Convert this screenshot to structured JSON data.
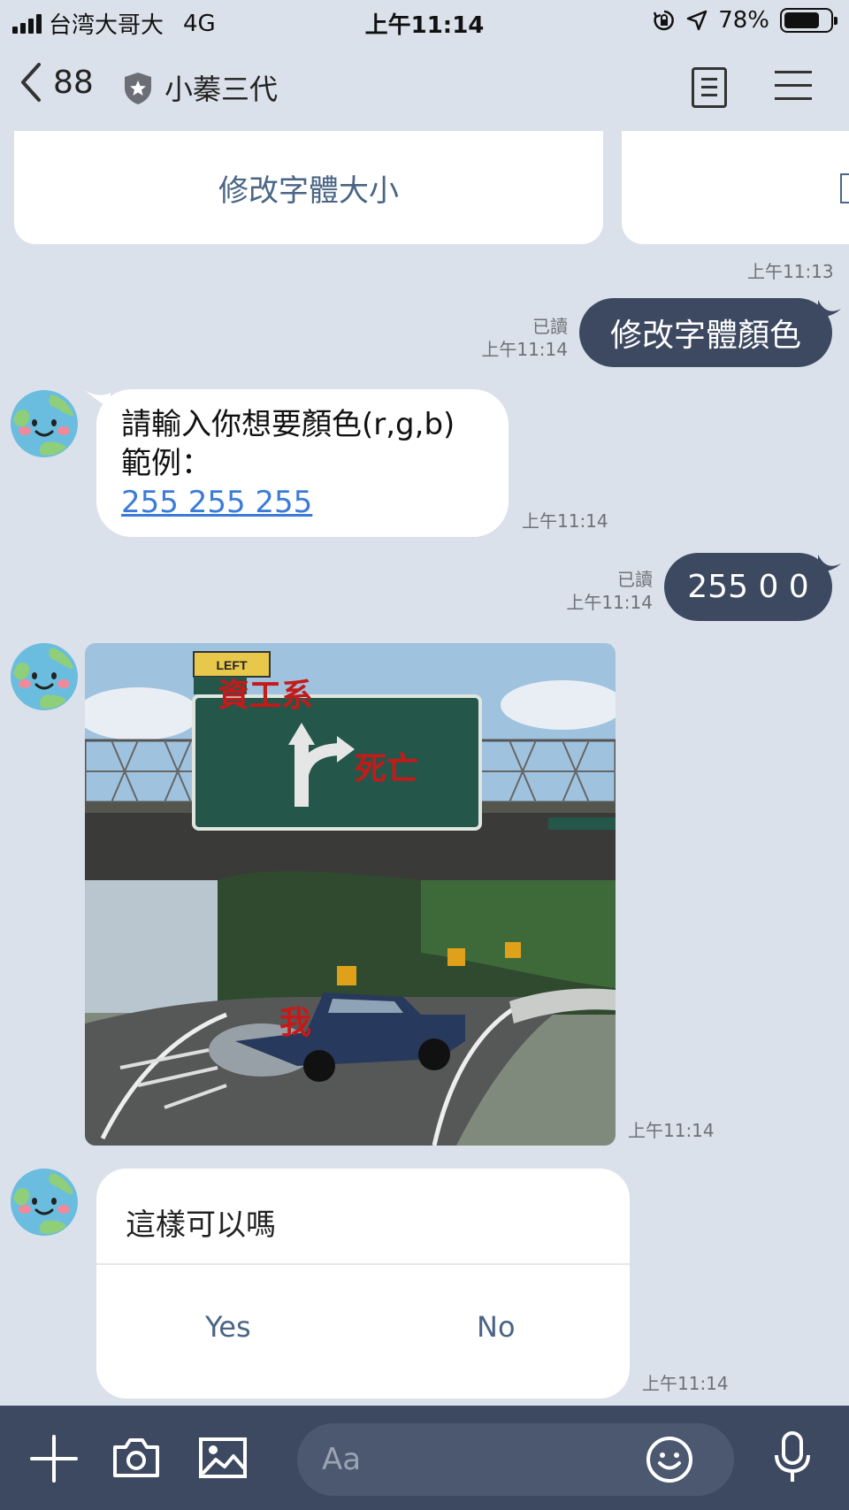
{
  "status_bar": {
    "carrier": "台湾大哥大",
    "network": "4G",
    "time": "上午11:14",
    "battery": "78%",
    "battery_level": 0.78
  },
  "header": {
    "back_count": "88",
    "title": "小蓁三代"
  },
  "messages": {
    "card": {
      "action": "修改字體大小",
      "time": "上午11:13"
    },
    "out1": {
      "read": "已讀",
      "time": "上午11:14",
      "text": "修改字體顏色"
    },
    "in1": {
      "line1": "請輸入你想要顏色(r,g,b)",
      "line2": "範例：",
      "link": "255 255 255",
      "time": "上午11:14"
    },
    "out2": {
      "read": "已讀",
      "time": "上午11:14",
      "text": "255 0 0"
    },
    "image": {
      "sign_plate": "LEFT",
      "label_top": "資工系",
      "label_right": "死亡",
      "label_car": "我",
      "time": "上午11:14"
    },
    "confirm": {
      "question": "這樣可以嗎",
      "yes": "Yes",
      "no": "No",
      "time": "上午11:14"
    }
  },
  "input": {
    "placeholder": "Aa"
  },
  "colors": {
    "outgoing_bubble": "#3c4960",
    "background": "#dbe1ea",
    "accent": "#4a6585",
    "link": "#3b7bd8"
  }
}
